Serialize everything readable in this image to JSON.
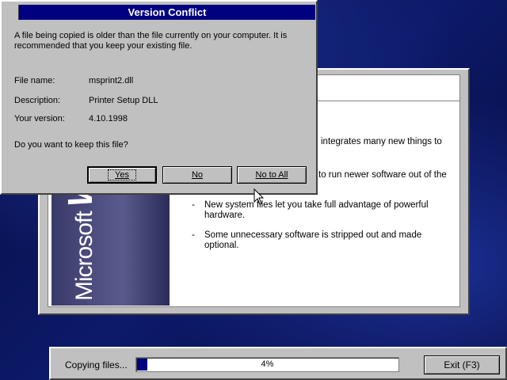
{
  "dialog": {
    "title": "Version Conflict",
    "message_line1": "A file being copied is older than the file currently on your computer. It is",
    "message_line2": "recommended that you keep your existing file.",
    "file_name_label": "File name:",
    "file_name_value": "msprint2.dll",
    "description_label": "Description:",
    "description_value": "Printer Setup DLL",
    "version_label": "Your version:",
    "version_value": "4.10.1998",
    "question": "Do you want to keep this file?",
    "buttons": {
      "yes": "Yes",
      "no": "No",
      "no_to_all": "No to All"
    }
  },
  "setup_background": {
    "banner_text_1": "Microsoft",
    "banner_text_2": "Wind",
    "partial_line_1": "integrates many new things to",
    "partial_line_2": "to run newer software out of the",
    "bullets": [
      {
        "line1": "New system files let you take full advantage of powerful",
        "line2": "hardware."
      },
      {
        "line1": "Some unnecessary software is stripped out and made",
        "line2": "optional."
      }
    ]
  },
  "progress": {
    "label": "Copying files...",
    "percent_text": "4%",
    "percent_value": 4,
    "exit_label": "Exit (F3)"
  },
  "colors": {
    "title_bar": "#000080",
    "progress_fill": "#000080",
    "dialog_face": "#c0c0c0"
  }
}
